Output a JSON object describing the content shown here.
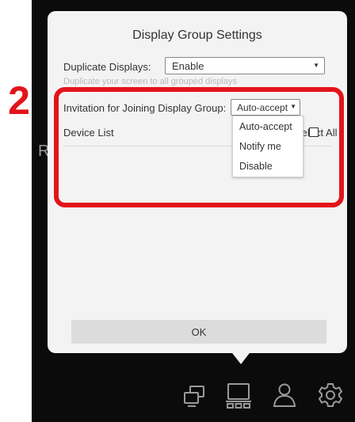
{
  "step_number": "2",
  "left_edge_letter": "R",
  "dialog": {
    "title": "Display Group Settings",
    "duplicate_label": "Duplicate Displays:",
    "duplicate_value": "Enable",
    "duplicate_hint": "Duplicate your screen to all grouped displays",
    "invitation_label": "Invitation for Joining Display Group:",
    "invitation_value": "Auto-accept",
    "device_list_label": "Device List",
    "select_all_label": "Select All",
    "ok_label": "OK"
  },
  "invitation_options": [
    "Auto-accept",
    "Notify me",
    "Disable"
  ],
  "taskbar_icons": [
    "screen-mirror-icon",
    "display-group-icon",
    "user-icon",
    "settings-gear-icon"
  ],
  "colors": {
    "highlight": "#e3141b",
    "dialog_bg": "#f3f3f3",
    "device_bg": "#0b0b0b"
  }
}
